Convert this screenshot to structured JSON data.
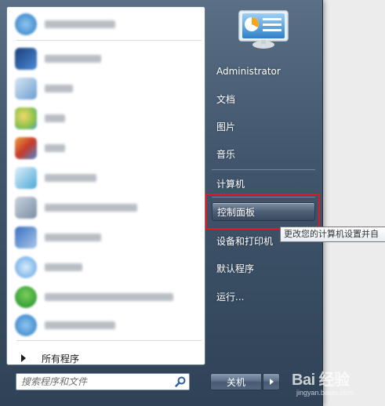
{
  "left_panel": {
    "all_programs_label": "所有程序",
    "search_placeholder": "搜索程序和文件",
    "items": [
      {
        "icon": "app-icon",
        "color": "#3a8fd8"
      },
      {
        "icon": "remote-desktop-icon",
        "color": "#2d5fa8"
      },
      {
        "icon": "calculator-icon",
        "color": "#6aa0d8"
      },
      {
        "icon": "paint-icon",
        "color": "#e0b040"
      },
      {
        "icon": "snipping-icon",
        "color": "#c84030"
      },
      {
        "icon": "xps-viewer-icon",
        "color": "#3aa0d0"
      },
      {
        "icon": "media-center-icon",
        "color": "#6a8aa8"
      },
      {
        "icon": "remote-connection-icon",
        "color": "#2a6fc0"
      },
      {
        "icon": "sticky-notes-icon",
        "color": "#6aa8e0"
      },
      {
        "icon": "download-manager-icon",
        "color": "#2a9a3a"
      },
      {
        "icon": "app-icon-2",
        "color": "#3a8fd8"
      }
    ]
  },
  "right_panel": {
    "user_name": "Administrator",
    "documents": "文档",
    "pictures": "图片",
    "music": "音乐",
    "computer": "计算机",
    "control_panel": "控制面板",
    "devices_printers": "设备和打印机",
    "default_programs": "默认程序",
    "run": "运行..."
  },
  "tooltip": {
    "text": "更改您的计算机设置并自"
  },
  "shutdown": {
    "label": "关机"
  },
  "watermark": {
    "text": "Bai 经验",
    "sub": "jingyan.baidu.com"
  },
  "colors": {
    "highlight": "#e0191e",
    "menu_dark": "#2f4257",
    "menu_light": "#5a6f86"
  }
}
